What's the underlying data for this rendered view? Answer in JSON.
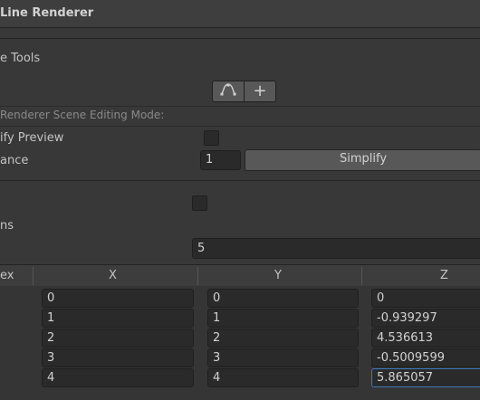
{
  "component": {
    "title": "Line Renderer"
  },
  "scene_tools": {
    "label": "e Tools",
    "edit_points_icon": "edit-points-icon",
    "add_point_icon": "plus-icon",
    "add_point_glyph": "+"
  },
  "mode_label": "Renderer Scene Editing Mode:",
  "simplify": {
    "preview_label": "ify Preview",
    "preview_checked": false,
    "tolerance_label": "ance",
    "tolerance_value": "1",
    "button_label": "Simplify"
  },
  "loop": {
    "checked": false
  },
  "positions": {
    "label": "ns",
    "size_value": "5",
    "headers": {
      "index": "ex",
      "x": "X",
      "y": "Y",
      "z": "Z"
    },
    "rows": [
      {
        "x": "0",
        "y": "0",
        "z": "0"
      },
      {
        "x": "1",
        "y": "1",
        "z": "-0.939297"
      },
      {
        "x": "2",
        "y": "2",
        "z": "4.536613"
      },
      {
        "x": "3",
        "y": "3",
        "z": "-0.5009599"
      },
      {
        "x": "4",
        "y": "4",
        "z": "5.865057"
      }
    ]
  }
}
